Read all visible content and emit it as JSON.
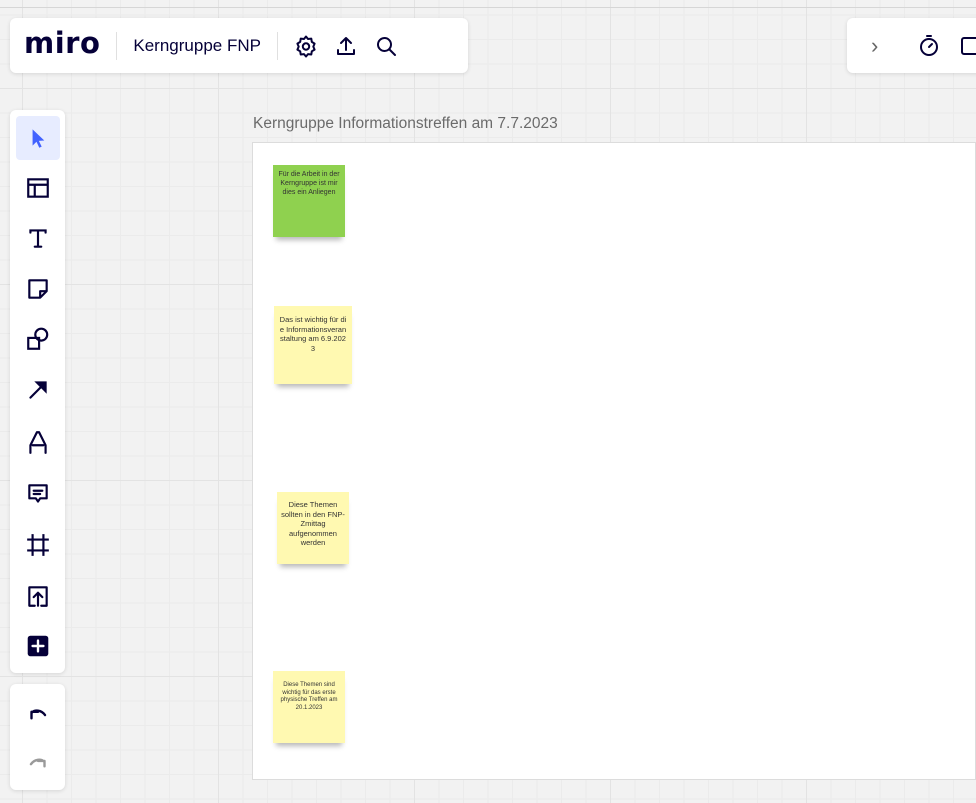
{
  "app": {
    "logo_text": "miro",
    "board_name": "Kerngruppe FNP"
  },
  "top_toolbar": {
    "icons": [
      "settings-icon",
      "upload-icon",
      "search-icon"
    ]
  },
  "top_right_toolbar": {
    "expand_label": "›",
    "icons": [
      "timer-icon",
      "present-icon"
    ]
  },
  "left_toolbar": {
    "tools": [
      {
        "name": "select-tool",
        "icon": "cursor-icon",
        "active": true
      },
      {
        "name": "templates-tool",
        "icon": "layout-icon"
      },
      {
        "name": "text-tool",
        "icon": "text-icon"
      },
      {
        "name": "sticky-note-tool",
        "icon": "sticky-note-icon"
      },
      {
        "name": "shapes-tool",
        "icon": "shapes-icon"
      },
      {
        "name": "connection-tool",
        "icon": "arrow-icon"
      },
      {
        "name": "pen-tool",
        "icon": "pen-icon"
      },
      {
        "name": "comment-tool",
        "icon": "comment-icon"
      },
      {
        "name": "frame-tool",
        "icon": "frame-icon"
      },
      {
        "name": "upload-tool",
        "icon": "upload-icon"
      },
      {
        "name": "more-apps-tool",
        "icon": "plus-icon"
      }
    ],
    "undo_icon": "undo-icon",
    "redo_icon": "redo-icon"
  },
  "frame": {
    "title": "Kerngruppe Informationstreffen am 7.7.2023"
  },
  "sticky_notes": [
    {
      "text": "Für die Arbeit in der Kerngruppe ist mir dies ein Anliegen",
      "color": "#8fd14f"
    },
    {
      "text": "Das ist wichtig für die Informationsveranstaltung am 6.9.2023",
      "color": "#fff9b1"
    },
    {
      "text": "Diese Themen sollten in den FNP-Zmittag aufgenommen werden",
      "color": "#fff9b1"
    },
    {
      "text": "Diese Themen sind wichtig für das erste physische Treffen am 20.1.2023",
      "color": "#fff9b1"
    }
  ],
  "colors": {
    "brand": "#050038",
    "accent": "#4262ff",
    "active_tool_bg": "#e7ecff"
  }
}
